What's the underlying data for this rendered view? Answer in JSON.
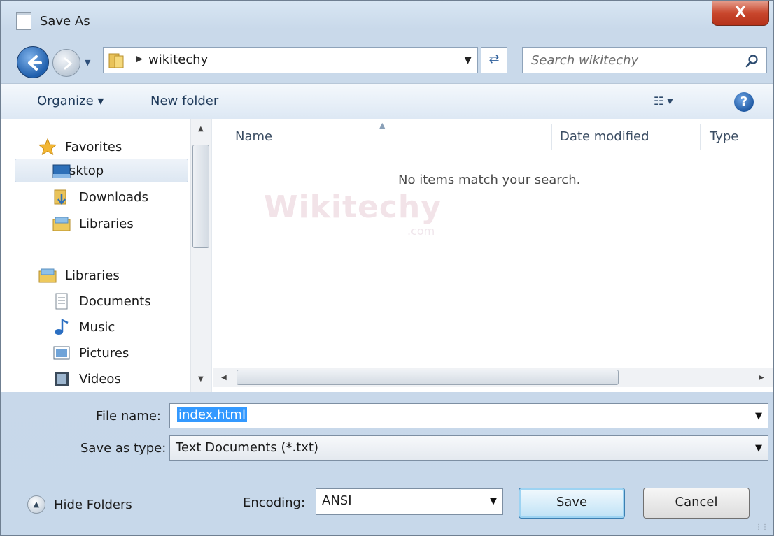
{
  "window": {
    "title": "Save As",
    "close_label": "X"
  },
  "address": {
    "crumb": "wikitechy"
  },
  "search": {
    "placeholder": "Search wikitechy"
  },
  "toolbar": {
    "organize": "Organize ▾",
    "new_folder": "New folder",
    "views": "☷ ▾",
    "help": "?"
  },
  "nav": {
    "favorites": "Favorites",
    "items_fav": [
      "Desktop",
      "Downloads",
      "Libraries"
    ],
    "libraries": "Libraries",
    "items_lib": [
      "Documents",
      "Music",
      "Pictures",
      "Videos"
    ]
  },
  "columns": {
    "name": "Name",
    "date_modified": "Date modified",
    "type": "Type"
  },
  "empty_message": "No items match your search.",
  "watermark": {
    "main": "Wikitechy",
    "sub": ".com"
  },
  "form": {
    "file_name_label": "File name:",
    "file_name_value": "index.html",
    "save_type_label": "Save as type:",
    "save_type_value": "Text Documents (*.txt)",
    "encoding_label": "Encoding:",
    "encoding_value": "ANSI"
  },
  "buttons": {
    "hide_folders": "Hide Folders",
    "save": "Save",
    "cancel": "Cancel"
  },
  "colors": {
    "selection": "#3399ff",
    "close": "#c9472d",
    "accent": "#1f5fad"
  }
}
